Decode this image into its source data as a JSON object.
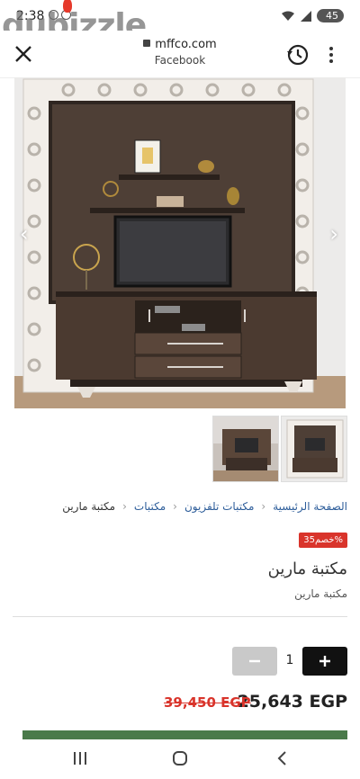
{
  "status": {
    "time": "2:38",
    "battery": "45"
  },
  "watermark": "dubizzle",
  "browser": {
    "url": "mffco.com",
    "source": "Facebook"
  },
  "breadcrumb": [
    "الصفحة الرئيسية",
    "مكتبات تلفزيون",
    "مكتبات",
    "مكتبة مارين"
  ],
  "product": {
    "discount_badge": "خصم35%",
    "title": "مكتبة مارين",
    "subtitle": "مكتبة مارين",
    "quantity": "1",
    "price": "25,643 EGP",
    "old_price": "39,450 EGP"
  },
  "colors": {
    "accent_red": "#d9342b",
    "cta_green": "#4a7a4a",
    "link_blue": "#2d5d9a"
  }
}
